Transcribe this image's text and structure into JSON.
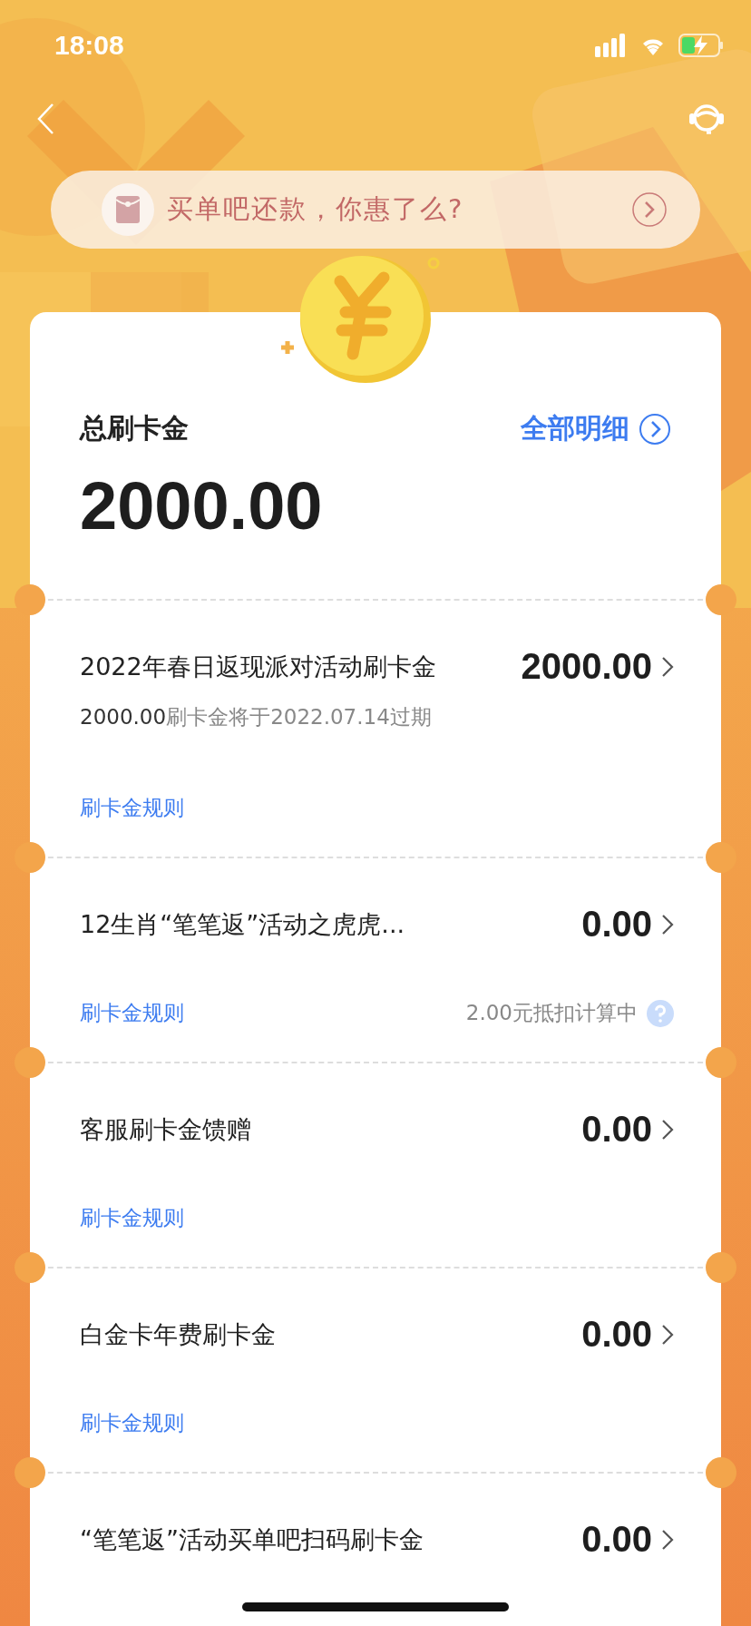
{
  "status_bar": {
    "time": "18:08"
  },
  "banner": {
    "text": "买单吧还款，你惠了么?"
  },
  "summary": {
    "label": "总刷卡金",
    "amount": "2000.00",
    "detail_link": "全部明细"
  },
  "items": [
    {
      "title": "2022年春日返现派对活动刷卡金",
      "amount": "2000.00",
      "expiry_amount": "2000.00",
      "expiry_text": "刷卡金将于2022.07.14过期",
      "rules_link": "刷卡金规则"
    },
    {
      "title": "12生肖“笔笔返”活动之虎虎...",
      "amount": "0.00",
      "rules_link": "刷卡金规则",
      "note": "2.00元抵扣计算中"
    },
    {
      "title": "客服刷卡金馈赠",
      "amount": "0.00",
      "rules_link": "刷卡金规则"
    },
    {
      "title": "白金卡年费刷卡金",
      "amount": "0.00",
      "rules_link": "刷卡金规则"
    },
    {
      "title": "“笔笔返”活动买单吧扫码刷卡金",
      "amount": "0.00"
    }
  ]
}
